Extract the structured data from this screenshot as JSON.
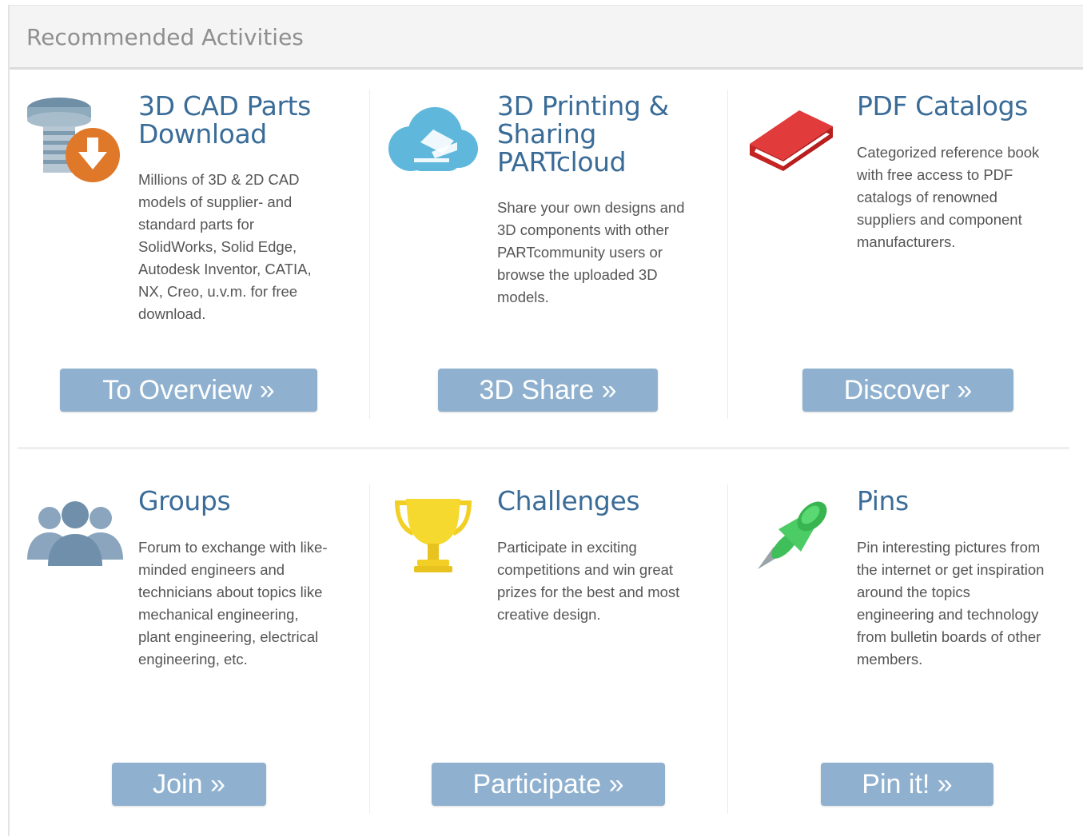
{
  "panel": {
    "title": "Recommended Activities"
  },
  "cards": [
    {
      "title": [
        "3D CAD Parts",
        "Download"
      ],
      "text": [
        "Millions of 3D & 2D CAD",
        "models of supplier- and",
        "standard parts for",
        "SolidWorks, Solid Edge,",
        "Autodesk Inventor, CATIA,",
        "NX, Creo, u.v.m. for free",
        "download."
      ],
      "button": "To Overview »",
      "icon": "cad-download-icon"
    },
    {
      "title": [
        "3D Printing &",
        "Sharing",
        "PARTcloud"
      ],
      "text": [
        "Share your own designs and",
        "3D components with other",
        "PARTcommunity users or",
        "browse the uploaded 3D",
        "models."
      ],
      "button": "3D Share »",
      "icon": "cloud-share-icon"
    },
    {
      "title": [
        "PDF Catalogs"
      ],
      "text": [
        "Categorized reference book",
        "with free access to PDF",
        "catalogs of renowned",
        "suppliers and component",
        "manufacturers."
      ],
      "button": "Discover »",
      "icon": "book-icon"
    },
    {
      "title": [
        "Groups"
      ],
      "text": [
        "Forum to exchange with like-",
        "minded engineers and",
        "technicians about topics like",
        "mechanical engineering,",
        "plant engineering, electrical",
        "engineering, etc."
      ],
      "button": "Join »",
      "icon": "group-icon"
    },
    {
      "title": [
        "Challenges"
      ],
      "text": [
        "Participate in exciting",
        "competitions and win great",
        "prizes for the best and most",
        "creative design."
      ],
      "button": "Participate »",
      "icon": "trophy-icon"
    },
    {
      "title": [
        "Pins"
      ],
      "text": [
        "Pin interesting pictures from",
        "the internet or get inspiration",
        "around the topics",
        "engineering and technology",
        "from bulletin boards of other",
        "members."
      ],
      "button": "Pin it! »",
      "icon": "pushpin-icon"
    }
  ],
  "colors": {
    "accent": "#3a6c98",
    "button": "#8fb1cf",
    "header_bg": "#f4f4f4"
  }
}
